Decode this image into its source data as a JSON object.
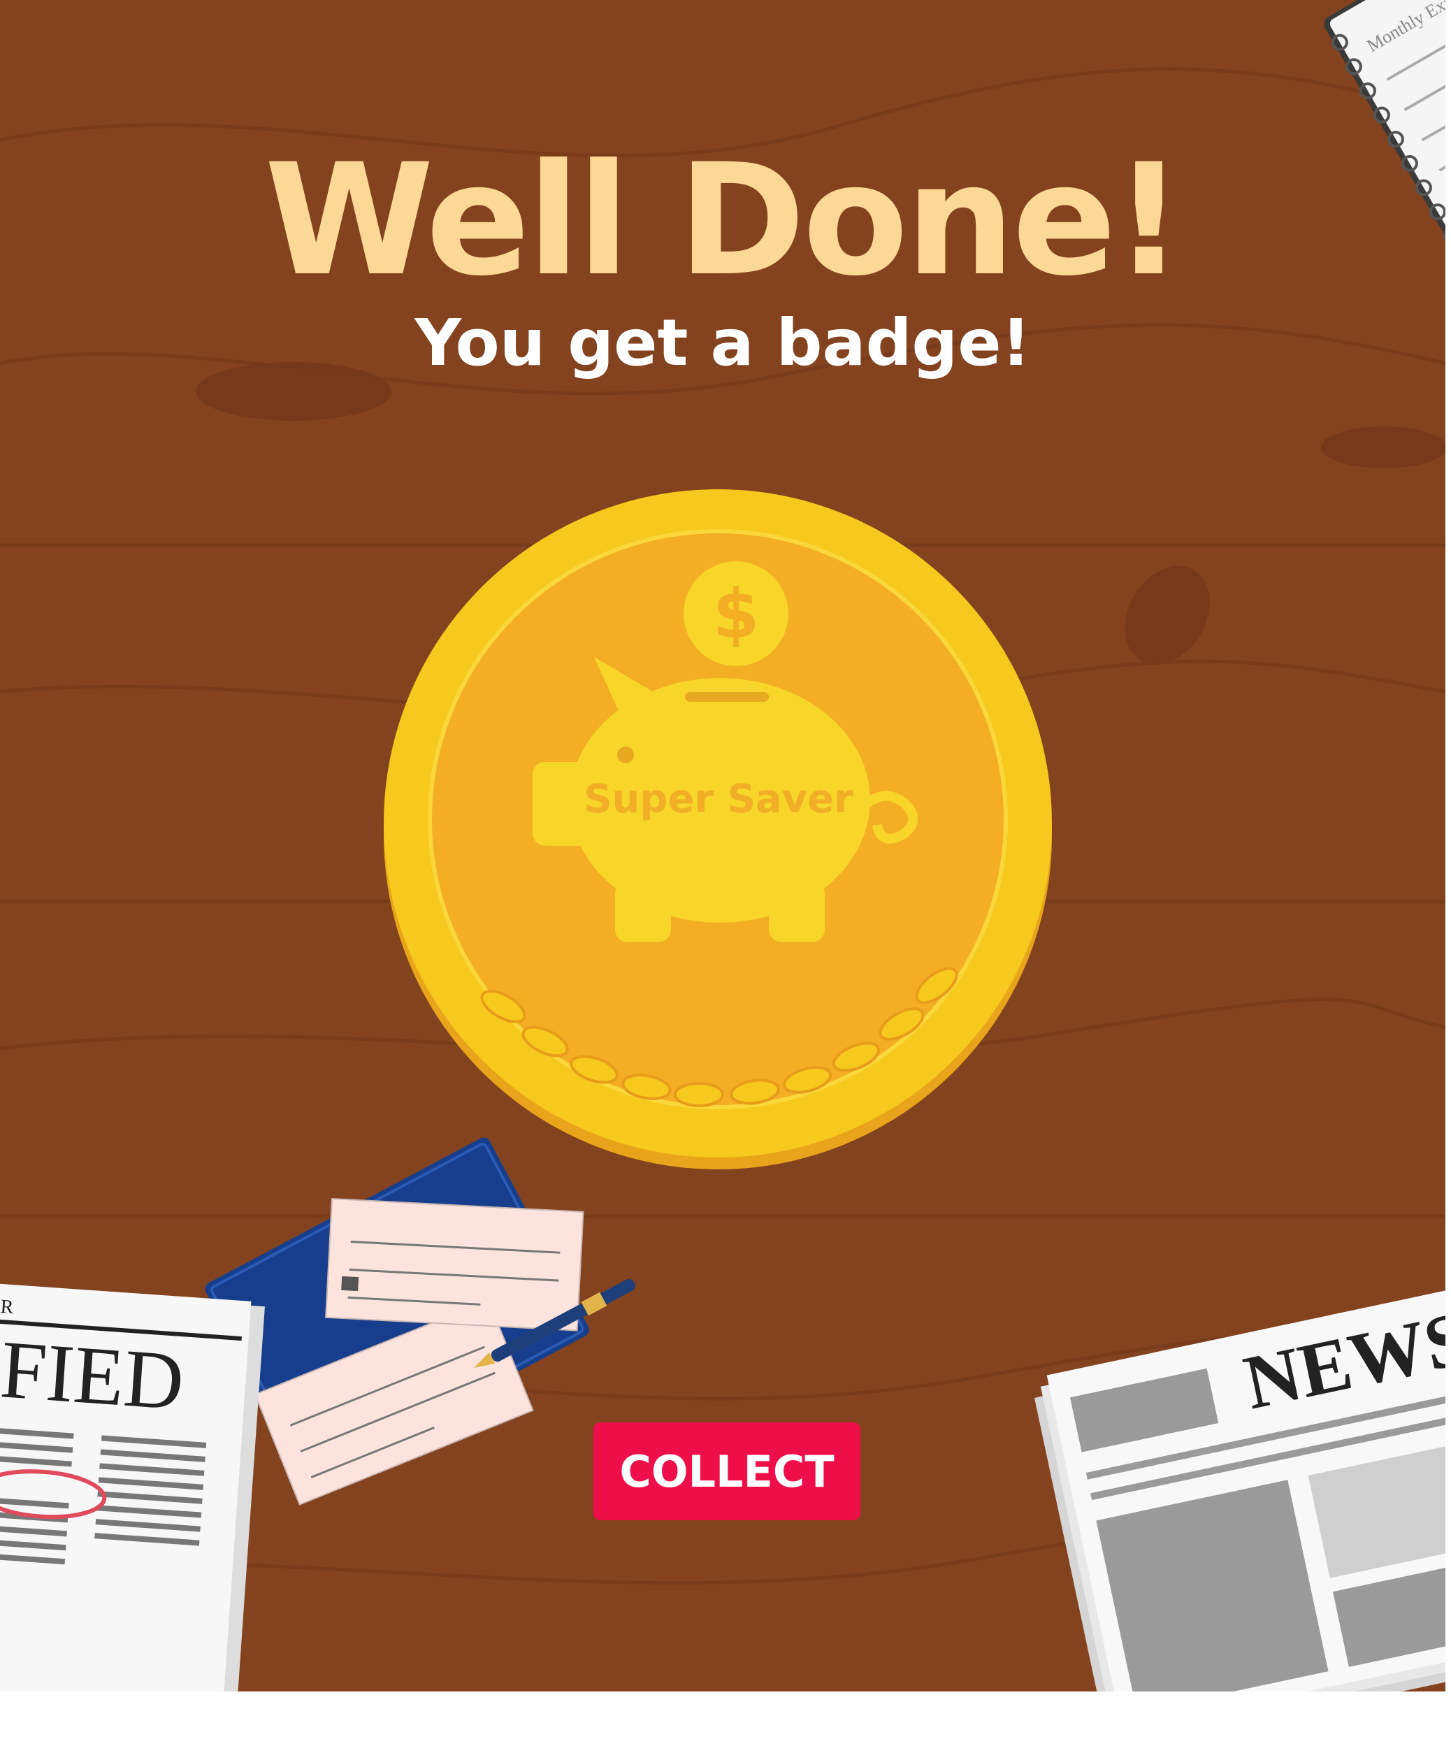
{
  "reward": {
    "title": "Well Done!",
    "subtitle": "You get a badge!",
    "badge_label": "Super Saver",
    "badge_icon": "piggy-bank-icon",
    "coin_symbol": "$",
    "collect_label": "COLLECT"
  },
  "props": {
    "notebook_label": "Monthly Expen",
    "newspaper_left_headline": "IFIED",
    "newspaper_left_masthead": "PER",
    "newspaper_right_headline": "NEWS"
  },
  "colors": {
    "wood": "#84431f",
    "title": "#fbd896",
    "coin_outer": "#f7c81e",
    "coin_inner": "#f3ae24",
    "collect_button": "#ee0f4a"
  }
}
